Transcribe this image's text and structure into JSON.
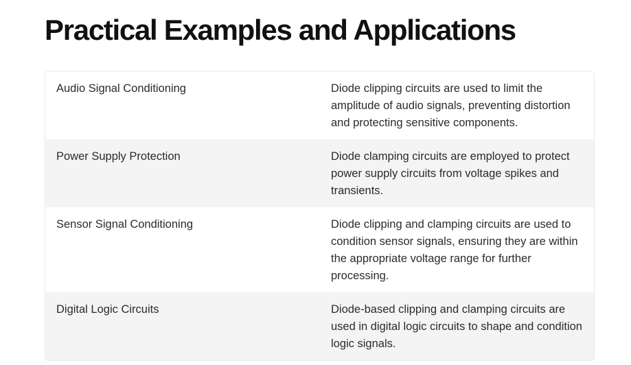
{
  "page": {
    "title": "Practical Examples and Applications"
  },
  "table": {
    "rows": [
      {
        "application": "Audio Signal Conditioning",
        "description": "Diode clipping circuits are used to limit the amplitude of audio signals, preventing distortion and protecting sensitive components."
      },
      {
        "application": "Power Supply Protection",
        "description": "Diode clamping circuits are employed to protect power supply circuits from voltage spikes and transients."
      },
      {
        "application": "Sensor Signal Conditioning",
        "description": "Diode clipping and clamping circuits are used to condition sensor signals, ensuring they are within the appropriate voltage range for further processing."
      },
      {
        "application": "Digital Logic Circuits",
        "description": "Diode-based clipping and clamping circuits are used in digital logic circuits to shape and condition logic signals."
      }
    ]
  },
  "colors": {
    "row_alt_background": "#f4f4f4",
    "border": "#e8e8e8",
    "text": "#2b2b2b"
  }
}
